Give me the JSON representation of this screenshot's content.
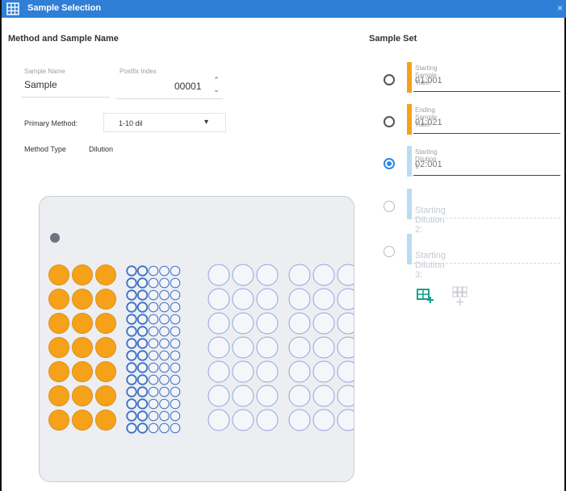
{
  "window": {
    "title": "Sample Selection",
    "close_glyph": "×"
  },
  "left": {
    "header": "Method and Sample Name",
    "sample_name": {
      "label": "Sample Name",
      "value": "Sample"
    },
    "postfix_index": {
      "label": "Postfix Index",
      "value": "00001",
      "up_glyph": "⌃",
      "down_glyph": "⌄"
    },
    "primary_method": {
      "label": "Primary Method:",
      "value": "1-10 dil",
      "caret": "▾"
    },
    "method_type": {
      "label": "Method Type",
      "value": "Dilution"
    }
  },
  "plate": {
    "marker_color": "#6f7380",
    "sample_fill": "#f5a21a",
    "small_well_stroke": "#3c6fc4",
    "large_well_stroke": "#8fa6dc",
    "sample_rows": 7,
    "sample_cols": 3,
    "dilution_small_cols": 5,
    "dilution_small_rows": 14,
    "small_filled_cols": 2,
    "large_rows": 7,
    "large_group_cols": 3,
    "large_groups": 2
  },
  "right": {
    "header": "Sample Set",
    "tubes": [
      {
        "label": "Starting Sample Tube:",
        "value": "01:001",
        "selected": false,
        "active": true,
        "bar_color": "#f5a21a"
      },
      {
        "label": "Ending Sample Tube:",
        "value": "01:021",
        "selected": false,
        "active": true,
        "bar_color": "#f5a21a"
      },
      {
        "label": "Starting Dilution 1",
        "value": "02:001",
        "selected": true,
        "active": true,
        "bar_color": "#b9dcf0"
      },
      {
        "label": "",
        "value": "Starting Dilution 2:",
        "selected": false,
        "active": false,
        "bar_color": "#b9dcf0"
      },
      {
        "label": "",
        "value": "Starting Dilution 3:",
        "selected": false,
        "active": false,
        "bar_color": "#b9dcf0"
      }
    ],
    "actions": {
      "add_plate_icon": "add-plate-icon",
      "add_tube_icon": "add-tube-icon",
      "accent": "#1aa08a"
    }
  }
}
